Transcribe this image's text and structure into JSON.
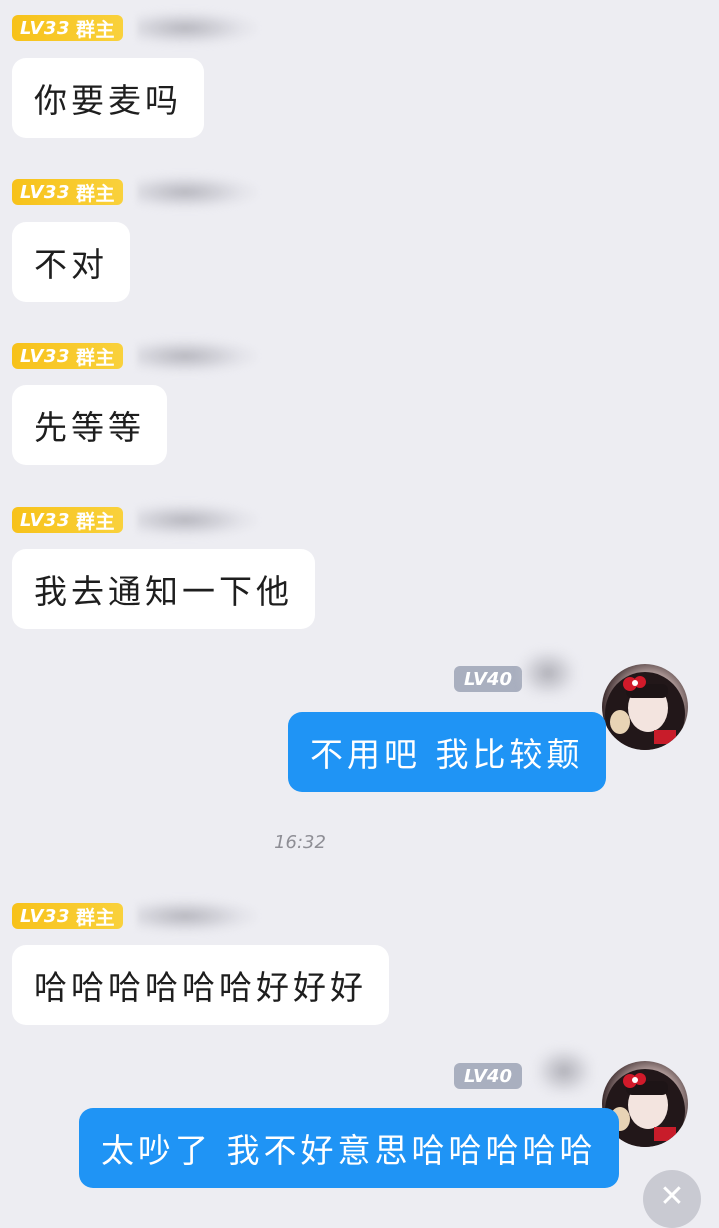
{
  "messages": [
    {
      "level": "LV33",
      "role": "群主",
      "text": "你要麦吗"
    },
    {
      "level": "LV33",
      "role": "群主",
      "text": "不对"
    },
    {
      "level": "LV33",
      "role": "群主",
      "text": "先等等"
    },
    {
      "level": "LV33",
      "role": "群主",
      "text": "我去通知一下他"
    },
    {
      "level": "LV40",
      "text": "不用吧 我比较颠"
    },
    {
      "timestamp": "16:32"
    },
    {
      "level": "LV33",
      "role": "群主",
      "text": "哈哈哈哈哈哈好好好"
    },
    {
      "level": "LV40",
      "text": "太吵了 我不好意思哈哈哈哈哈"
    }
  ],
  "floating_button": {
    "icon": "close-icon",
    "glyph": "✕"
  },
  "colors": {
    "background": "#ededf2",
    "incoming_bubble": "#ffffff",
    "outgoing_bubble": "#1f94f5",
    "owner_badge": "#f7c21a",
    "level_badge": "#a9afbf"
  }
}
